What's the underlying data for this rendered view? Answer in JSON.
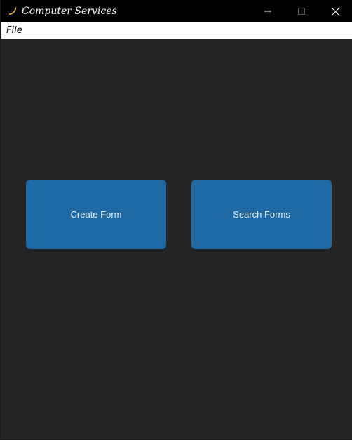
{
  "window": {
    "title": "Computer Services",
    "app_icon": "banana-icon",
    "controls": [
      "minimize-icon",
      "maximize-icon",
      "close-icon"
    ]
  },
  "menubar": {
    "items": [
      {
        "label": "File"
      }
    ]
  },
  "main": {
    "buttons": [
      {
        "label": "Create Form"
      },
      {
        "label": "Search Forms"
      }
    ]
  },
  "colors": {
    "titlebar": "#000000",
    "background": "#242424",
    "menubar": "#ffffff",
    "button": "#1f6aa5",
    "button_text": "#e8eef4"
  }
}
